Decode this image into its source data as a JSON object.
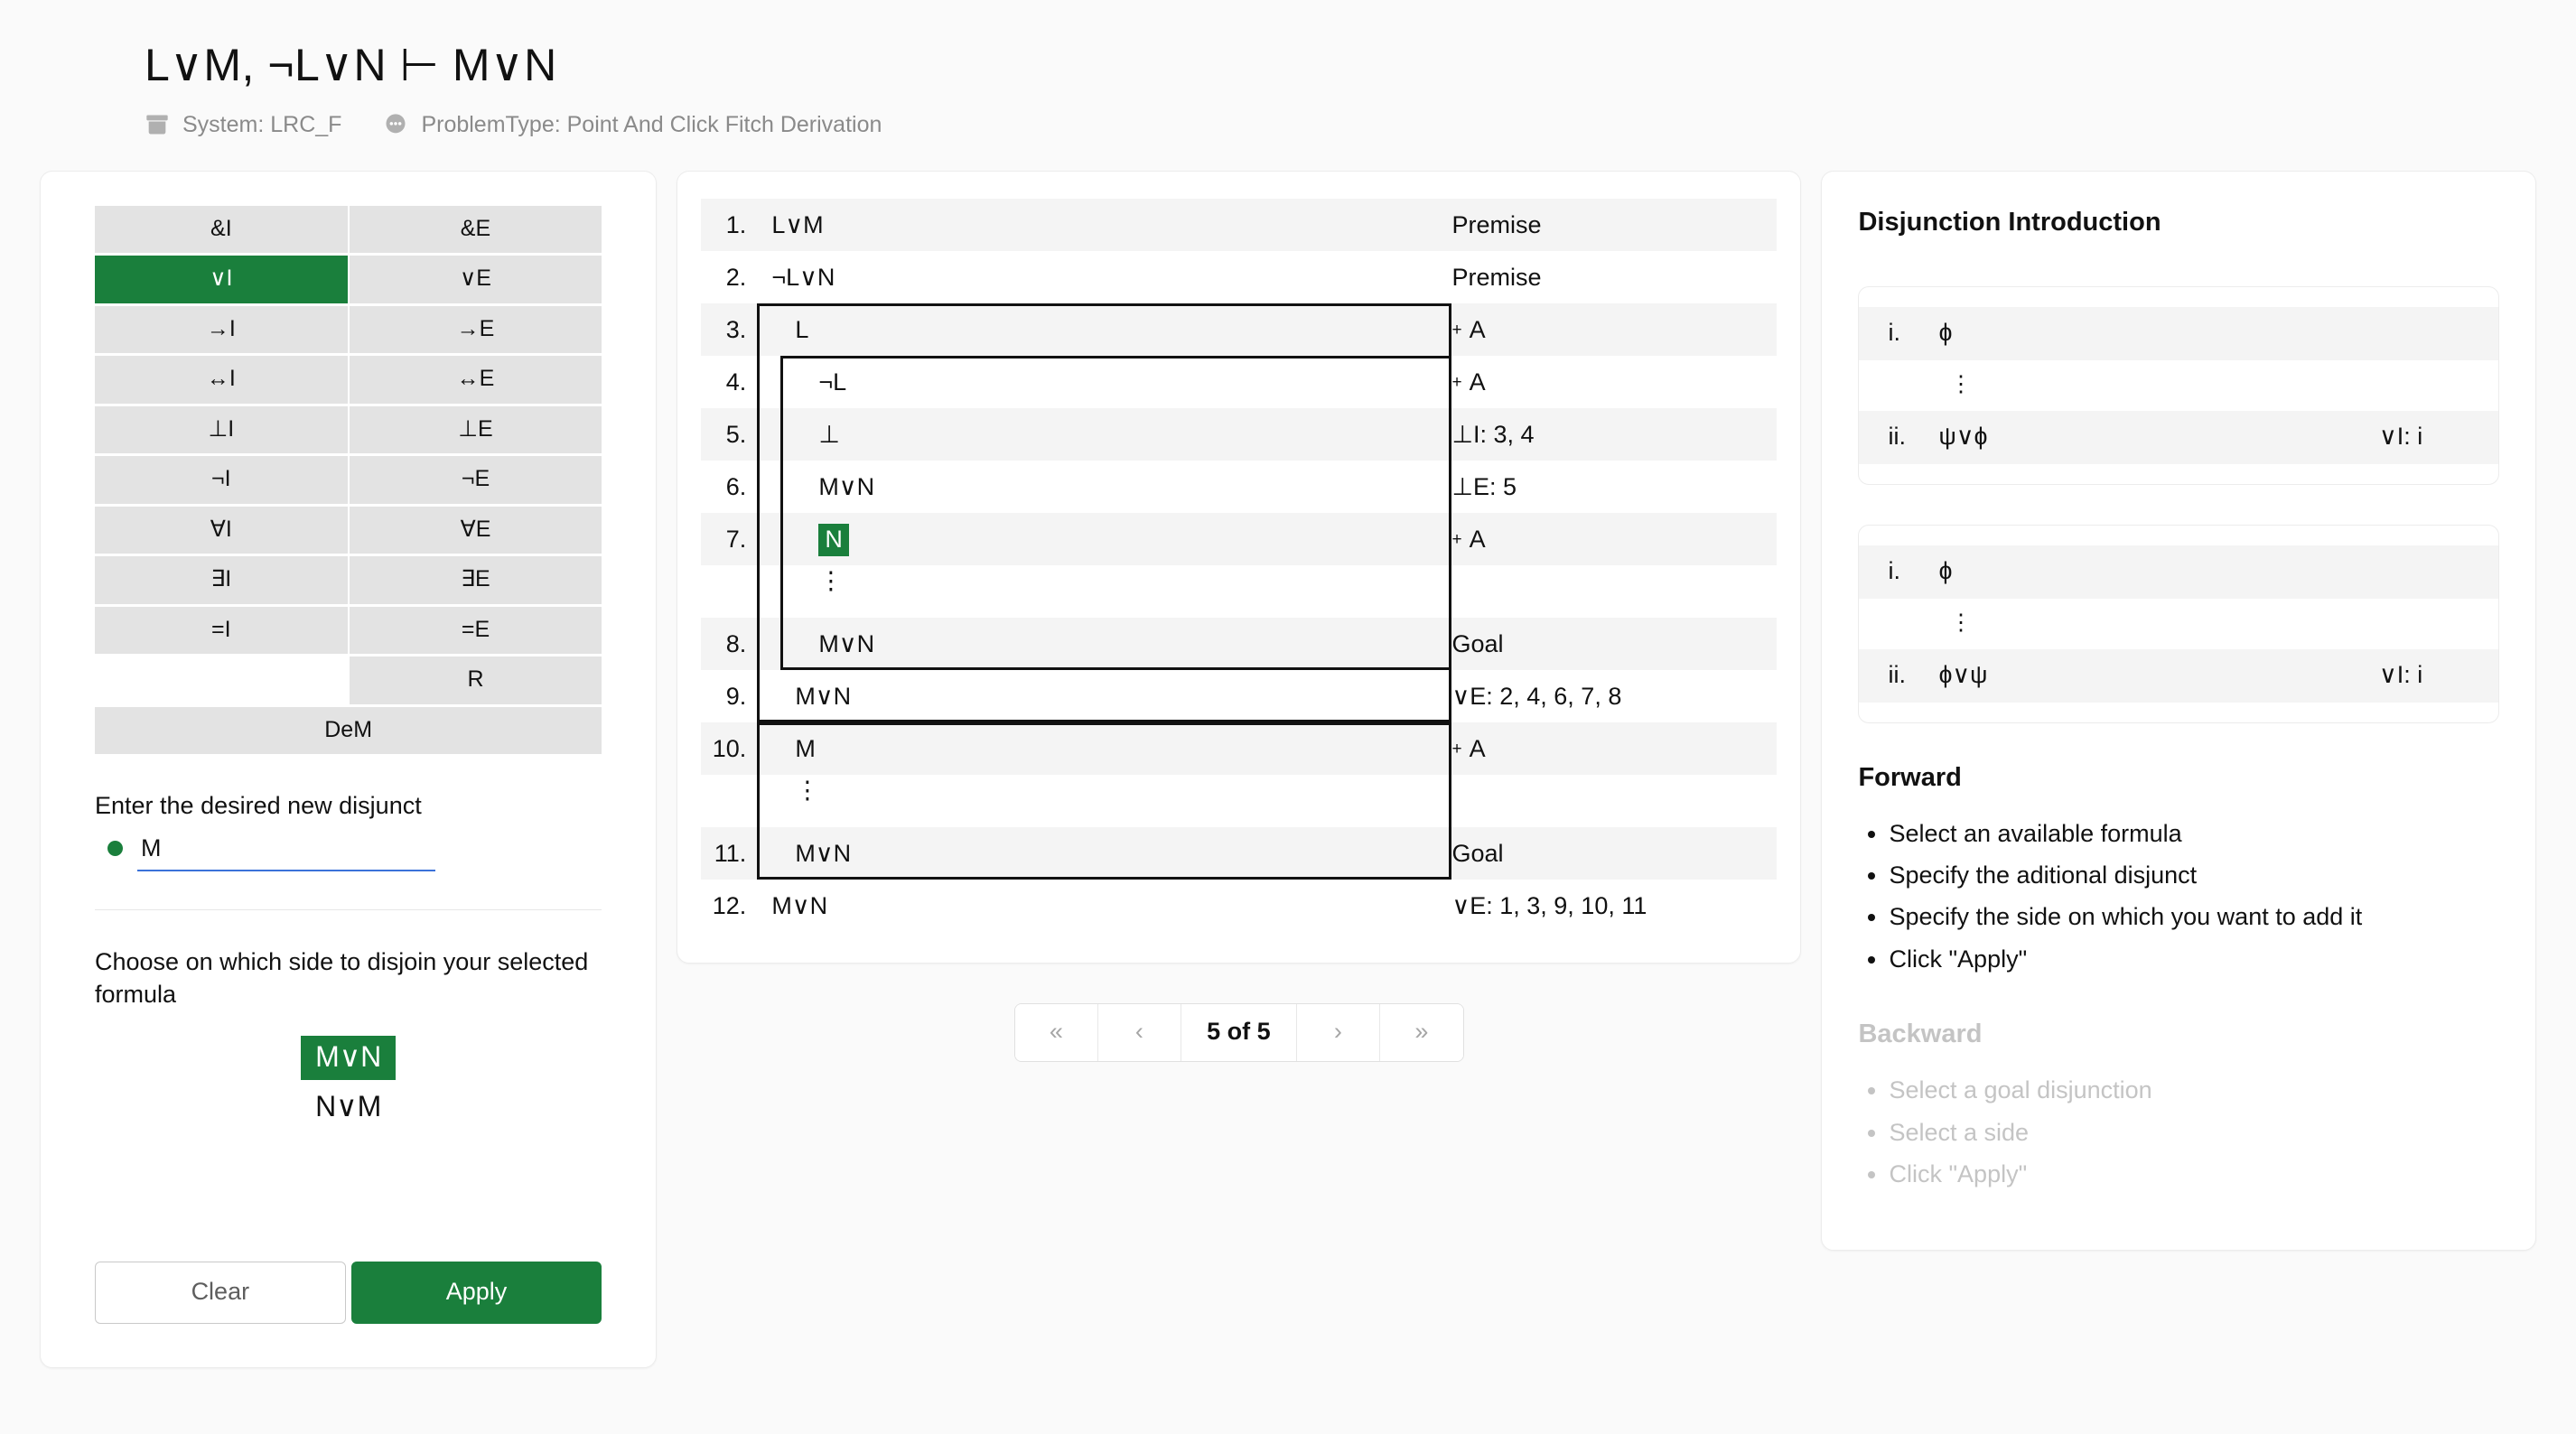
{
  "header": {
    "title": "L∨M, ¬L∨N ⊢ M∨N",
    "system_icon": "archive-icon",
    "system_text": "System: LRC_F",
    "problemtype_icon": "comment-dots-icon",
    "problemtype_text": "ProblemType: Point And Click Fitch Derivation"
  },
  "colors": {
    "accent_green": "#1a7f3c",
    "rule_button_bg": "#e3e3e3",
    "row_stripe": "#f4f4f4",
    "input_underline": "#3b72d9"
  },
  "rules": {
    "rows": [
      {
        "left": "&I",
        "right": "&E"
      },
      {
        "left": "∨I",
        "right": "∨E"
      },
      {
        "left": "→I",
        "right": "→E"
      },
      {
        "left": "↔I",
        "right": "↔E"
      },
      {
        "left": "⊥I",
        "right": "⊥E"
      },
      {
        "left": "¬I",
        "right": "¬E"
      },
      {
        "left": "∀I",
        "right": "∀E"
      },
      {
        "left": "∃I",
        "right": "∃E"
      },
      {
        "left": "=I",
        "right": "=E"
      },
      {
        "left": "",
        "right": "R"
      }
    ],
    "wide": "DeM",
    "selected": "∨I"
  },
  "disjunct": {
    "label": "Enter the desired new disjunct",
    "value": "M",
    "placeholder": ""
  },
  "side": {
    "label": "Choose on which side to disjoin your selected formula",
    "options": [
      {
        "text": "M∨N",
        "selected": true
      },
      {
        "text": "N∨M",
        "selected": false
      }
    ]
  },
  "actions": {
    "clear": "Clear",
    "apply": "Apply"
  },
  "proof": {
    "rows": [
      {
        "num": "1.",
        "formula": "L∨M",
        "justification": "Premise",
        "depth": 0,
        "assumption": false
      },
      {
        "num": "2.",
        "formula": "¬L∨N",
        "justification": "Premise",
        "depth": 0,
        "assumption": false
      },
      {
        "num": "3.",
        "formula": "L",
        "justification": "A",
        "depth": 1,
        "assumption": true
      },
      {
        "num": "4.",
        "formula": "¬L",
        "justification": "A",
        "depth": 2,
        "assumption": true
      },
      {
        "num": "5.",
        "formula": "⊥",
        "justification": "⊥I: 3, 4",
        "depth": 2,
        "assumption": false
      },
      {
        "num": "6.",
        "formula": "M∨N",
        "justification": "⊥E: 5",
        "depth": 2,
        "assumption": false
      },
      {
        "num": "7.",
        "formula": "N",
        "justification": "A",
        "depth": 2,
        "assumption": true,
        "highlighted": true
      },
      {
        "num": "",
        "formula": "⋮",
        "justification": "",
        "depth": 2,
        "assumption": false,
        "dots": true
      },
      {
        "num": "8.",
        "formula": "M∨N",
        "justification": "Goal",
        "depth": 2,
        "assumption": false
      },
      {
        "num": "9.",
        "formula": "M∨N",
        "justification": "∨E: 2, 4, 6, 7, 8",
        "depth": 1,
        "assumption": false
      },
      {
        "num": "10.",
        "formula": "M",
        "justification": "A",
        "depth": 1,
        "assumption": true
      },
      {
        "num": "",
        "formula": "⋮",
        "justification": "",
        "depth": 1,
        "assumption": false,
        "dots": true
      },
      {
        "num": "11.",
        "formula": "M∨N",
        "justification": "Goal",
        "depth": 1,
        "assumption": false
      },
      {
        "num": "12.",
        "formula": "M∨N",
        "justification": "∨E: 1, 3, 9, 10, 11",
        "depth": 0,
        "assumption": false
      }
    ]
  },
  "pager": {
    "first": "«",
    "prev": "‹",
    "label": "5 of 5",
    "next": "›",
    "last": "»"
  },
  "info": {
    "title": "Disjunction Introduction",
    "schemas": [
      {
        "lines": [
          {
            "label": "i.",
            "formula": "ɸ",
            "just": "",
            "shade": true
          },
          {
            "label": "",
            "formula": "⋮",
            "just": "",
            "shade": false,
            "dots": true
          },
          {
            "label": "ii.",
            "formula": "ψ∨ɸ",
            "just": "∨I: i",
            "shade": true
          }
        ]
      },
      {
        "lines": [
          {
            "label": "i.",
            "formula": "ɸ",
            "just": "",
            "shade": true
          },
          {
            "label": "",
            "formula": "⋮",
            "just": "",
            "shade": false,
            "dots": true
          },
          {
            "label": "ii.",
            "formula": "ɸ∨ψ",
            "just": "∨I: i",
            "shade": true
          }
        ]
      }
    ],
    "forward": {
      "title": "Forward",
      "steps": [
        "Select an available formula",
        "Specify the aditional disjunct",
        "Specify the side on which you want to add it",
        "Click \"Apply\""
      ]
    },
    "backward": {
      "title": "Backward",
      "steps": [
        "Select a goal disjunction",
        "Select a side",
        "Click \"Apply\""
      ]
    }
  }
}
